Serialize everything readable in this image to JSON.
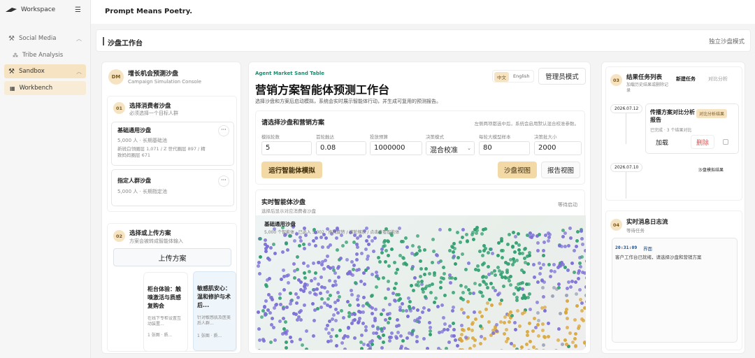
{
  "sidebar": {
    "workspace": "Workspace",
    "items": [
      {
        "label": "Social Media"
      },
      {
        "label": "Tribe Analysis"
      },
      {
        "label": "Sandbox"
      },
      {
        "label": "Workbench"
      }
    ]
  },
  "topbar": {
    "title": "Prompt Means Poetry."
  },
  "header": {
    "title": "沙盘工作台",
    "mode": "独立沙盘模式"
  },
  "left": {
    "avatar": "DM",
    "title": "增长机会预测沙盘",
    "subtitle": "Campaign Simulation Console",
    "step1": {
      "num": "01",
      "title": "选择消费者沙盘",
      "sub": "必须选择一个目标人群"
    },
    "sandbox1": {
      "title": "基础通用沙盘",
      "meta": "5,000 人 · 长期基础池",
      "desc": "新锐白领圈层 1,071 / Z 世代圈层 897 / 精致妈妈圈层 671",
      "more": "···"
    },
    "sandbox2": {
      "title": "指定人群沙盘",
      "meta": "5,000 人 · 长期指定池",
      "more": "···"
    },
    "step2": {
      "num": "02",
      "title": "选择或上传方案",
      "sub": "方案会被转成智能体输入"
    },
    "upload": "上传方案",
    "plans": [
      {
        "title": "柜台体验：触嗅激活与质感复购会",
        "desc": "在线下专柜设置互动装置...",
        "meta": "1 张图 · 质..."
      },
      {
        "title": "敏感肌安心：温和修护与术后...",
        "desc": "针对敏感肌及医美后人群...",
        "meta": "1 张图 · 质..."
      }
    ]
  },
  "center": {
    "eyebrow": "Agent Market Sand Table",
    "lang_cn": "中文",
    "lang_en": "English",
    "admin": "管理员模式",
    "title": "营销方案智能体预测工作台",
    "desc": "选择沙盘和方案后启动模拟，系统会实时展示智能体行动，并生成可复用的预测报告。",
    "form": {
      "title": "请选择沙盘和营销方案",
      "hint": "左侧两项都选中后，系统会启用默认混合校准参数。",
      "fields": [
        {
          "label": "模拟轮数",
          "value": "5"
        },
        {
          "label": "首轮触达",
          "value": "0.08"
        },
        {
          "label": "投放预算",
          "value": "1000000"
        },
        {
          "label": "决策模式",
          "value": "混合校准"
        },
        {
          "label": "每轮大模型样本",
          "value": "80"
        },
        {
          "label": "决策批大小",
          "value": "2000"
        }
      ],
      "run": "运行智能体模拟",
      "view_sandbox": "沙盘视图",
      "view_report": "报告视图"
    },
    "live": {
      "title": "实时智能体沙盘",
      "sub": "选择后显示对应消费者沙盘",
      "status": "等待启动",
      "map_title": "基础通用沙盘",
      "map_sub": "5,000 个智能体 · 已选入 5,002 · 拖拽旋转 / 滚轮缩放 / 点击查看智能体"
    }
  },
  "right": {
    "step3": {
      "num": "03",
      "title": "结果任务列表",
      "sub": "加载历史结果或删除记录",
      "new": "新建任务",
      "compare": "对比分析"
    },
    "tasks": [
      {
        "date": "2026.07.12",
        "title": "传播方案对比分析报告",
        "badge": "对比分析结果",
        "status": "已完成 · 3 个结果对比",
        "load": "加载",
        "delete": "删除"
      },
      {
        "date": "2026.07.10",
        "label": "沙盘模拟结果"
      }
    ],
    "step4": {
      "num": "04",
      "title": "实时消息日志流",
      "sub": "等待任务"
    },
    "log": {
      "time": "20:31:09",
      "tag": "界面",
      "msg": "客户工作台已就绪，请选择沙盘和营销方案"
    }
  },
  "colors": {
    "accent": "#f6e3c2",
    "accent_text": "#7a5a20",
    "delete": "#d9534f",
    "teal": "#1f8a6e"
  },
  "scatter_palette": [
    "#7c6fd6",
    "#2f9e6e",
    "#d9a63a",
    "#9aa3b5"
  ]
}
